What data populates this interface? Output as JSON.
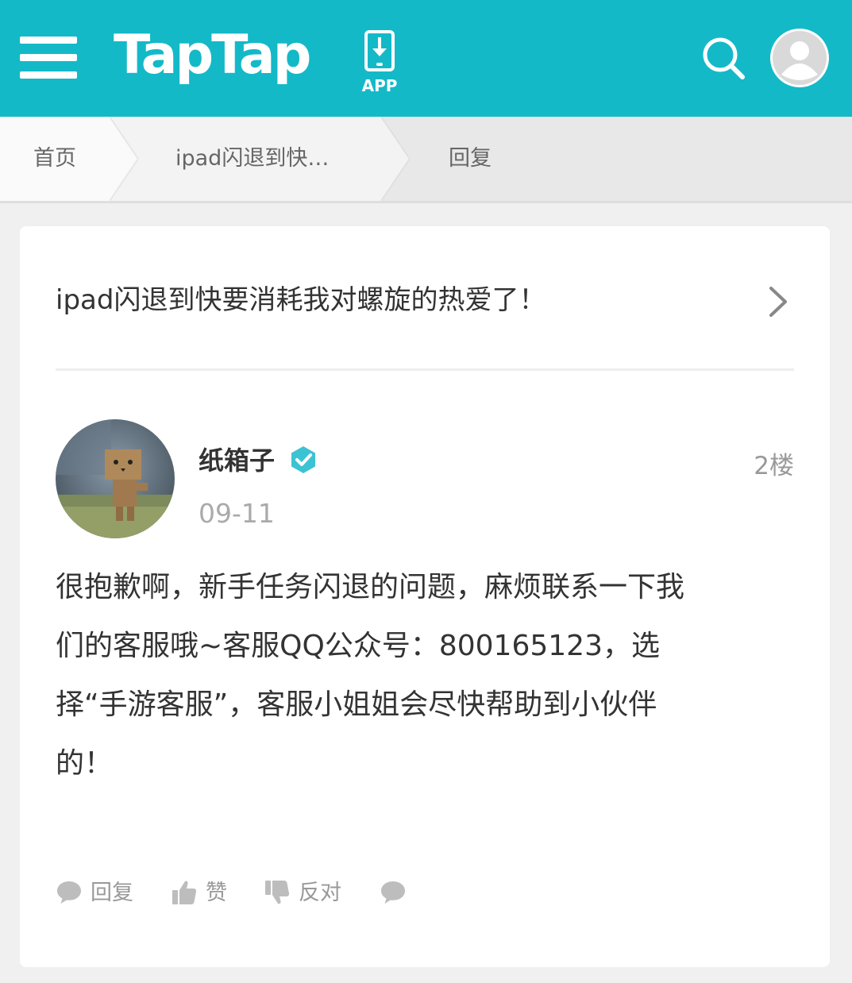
{
  "header": {
    "logo_text": "TapTap",
    "app_label": "APP",
    "brand_color": "#14b9c8"
  },
  "breadcrumb": {
    "home": "首页",
    "thread": "ipad闪退到快…",
    "current": "回复"
  },
  "thread": {
    "title": "ipad闪退到快要消耗我对螺旋的热爱了！"
  },
  "post": {
    "username": "纸箱子",
    "verified": true,
    "floor": "2楼",
    "date": "09-11",
    "content_lines": [
      "很抱歉啊，新手任务闪退的问题，麻烦联系一下我",
      "们的客服哦~客服QQ公众号：800165123，选",
      "择“手游客服”，客服小姐姐会尽快帮助到小伙伴",
      "的！"
    ]
  },
  "actions": {
    "reply": "回复",
    "like": "赞",
    "dislike": "反对"
  },
  "icons": {
    "menu": "menu-icon",
    "download": "phone-download-icon",
    "search": "search-icon",
    "user": "user-icon",
    "verified": "verified-badge-icon",
    "chevron": "chevron-right-icon",
    "comment": "comment-icon",
    "thumbs_up": "thumbs-up-icon",
    "thumbs_down": "thumbs-down-icon"
  }
}
